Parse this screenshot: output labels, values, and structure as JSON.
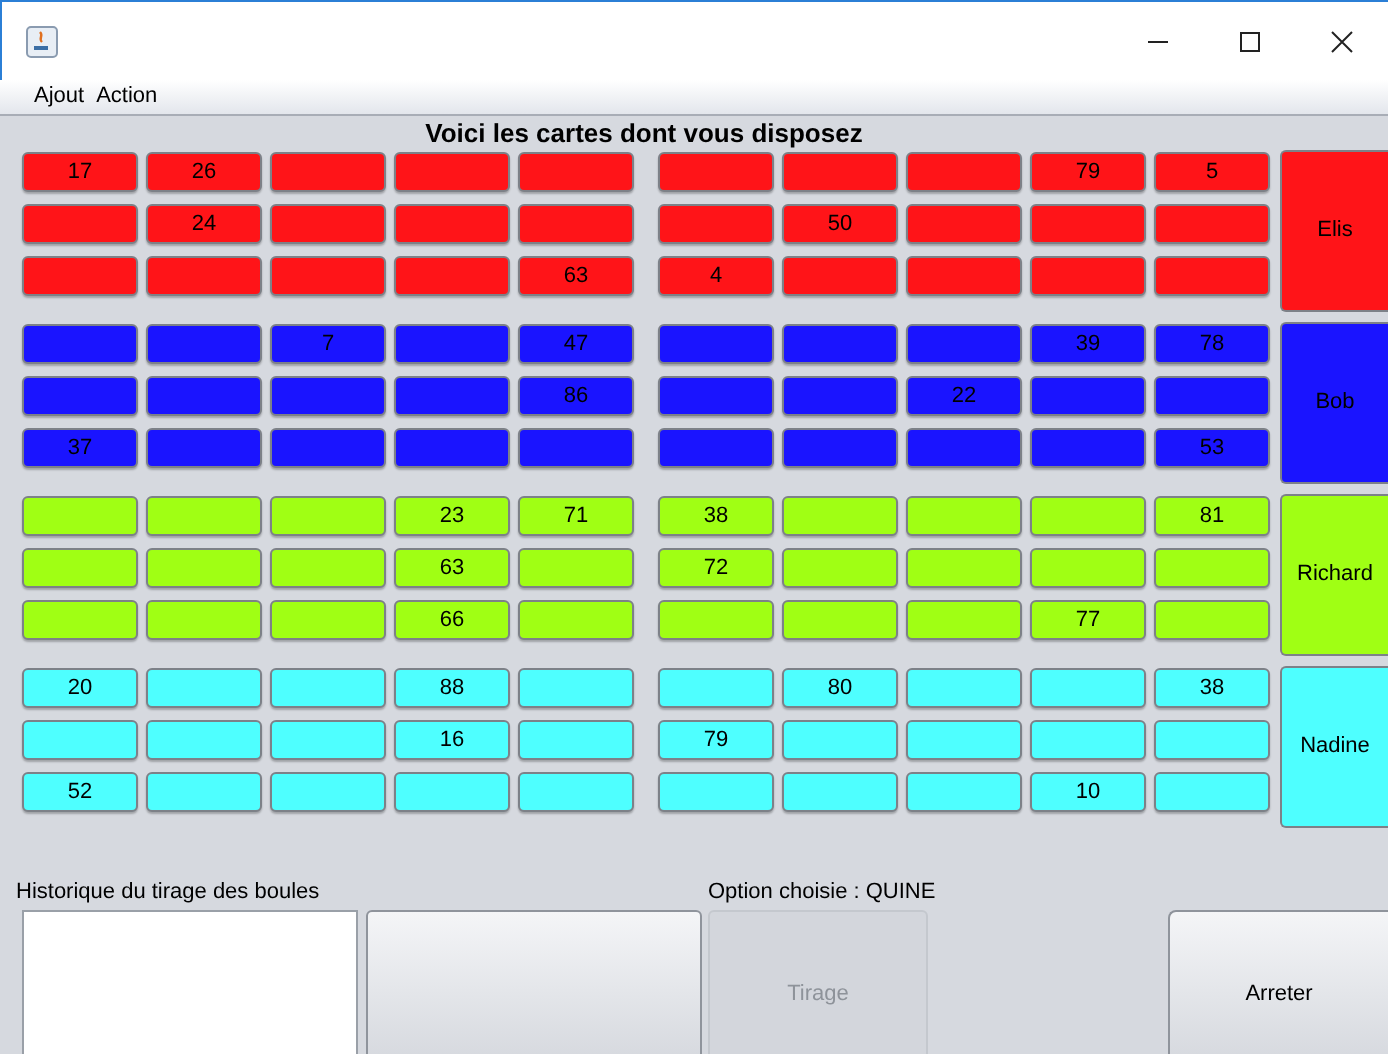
{
  "menu": [
    {
      "label": "Ajout"
    },
    {
      "label": "Action"
    }
  ],
  "heading": "Voici les cartes dont vous disposez",
  "players": [
    {
      "name": "Elis",
      "color": "#ff1418",
      "rows": [
        [
          "17",
          "26",
          null,
          null,
          null,
          null,
          null,
          null,
          "79",
          "5"
        ],
        [
          null,
          "24",
          null,
          null,
          null,
          null,
          "50",
          null,
          null,
          null
        ],
        [
          null,
          null,
          null,
          null,
          "63",
          "4",
          null,
          null,
          null,
          null
        ]
      ]
    },
    {
      "name": "Bob",
      "color": "#1a14ff",
      "rows": [
        [
          null,
          null,
          "7",
          null,
          "47",
          null,
          null,
          null,
          "39",
          "78"
        ],
        [
          null,
          null,
          null,
          null,
          "86",
          null,
          null,
          "22",
          null,
          null
        ],
        [
          "37",
          null,
          null,
          null,
          null,
          null,
          null,
          null,
          null,
          "53"
        ]
      ]
    },
    {
      "name": "Richard",
      "color": "#a0ff14",
      "rows": [
        [
          null,
          null,
          null,
          "23",
          "71",
          "38",
          null,
          null,
          null,
          "81"
        ],
        [
          null,
          null,
          null,
          "63",
          null,
          "72",
          null,
          null,
          null,
          null
        ],
        [
          null,
          null,
          null,
          "66",
          null,
          null,
          null,
          null,
          "77",
          null
        ]
      ]
    },
    {
      "name": "Nadine",
      "color": "#4effff",
      "rows": [
        [
          "20",
          null,
          null,
          "88",
          null,
          null,
          "80",
          null,
          null,
          "38"
        ],
        [
          null,
          null,
          null,
          "16",
          null,
          "79",
          null,
          null,
          null,
          null
        ],
        [
          "52",
          null,
          null,
          null,
          null,
          null,
          null,
          null,
          "10",
          null
        ]
      ]
    }
  ],
  "history_label": "Historique du tirage des boules",
  "option_label": "Option choisie : QUINE",
  "draw_button": {
    "label": "Tirage",
    "disabled": true
  },
  "stop_button": {
    "label": "Arreter",
    "disabled": false
  }
}
